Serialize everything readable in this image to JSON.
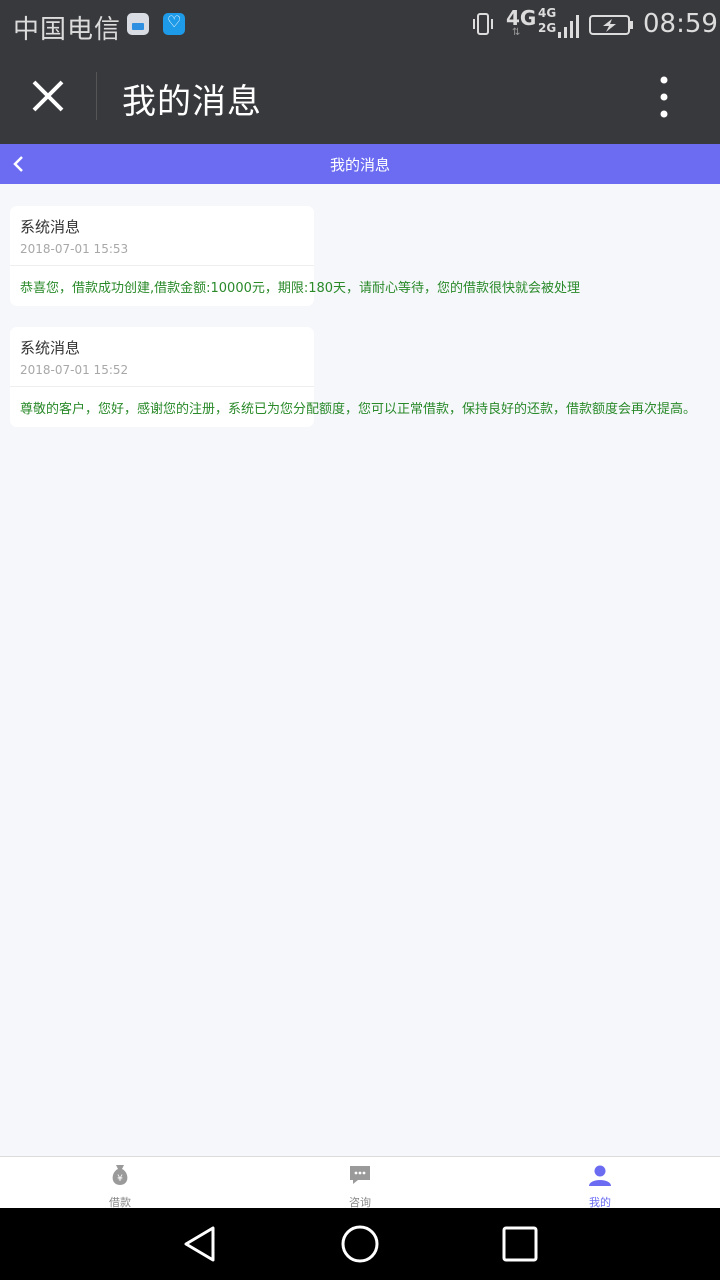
{
  "status_bar": {
    "carrier": "中国电信",
    "network_primary": "4G",
    "network_secondary": "4G\n2G",
    "time": "08:59"
  },
  "app_header": {
    "title": "我的消息"
  },
  "web_nav": {
    "title": "我的消息"
  },
  "messages": [
    {
      "title": "系统消息",
      "time": "2018-07-01 15:53",
      "body": "恭喜您，借款成功创建,借款金额:10000元，期限:180天，请耐心等待，您的借款很快就会被处理"
    },
    {
      "title": "系统消息",
      "time": "2018-07-01 15:52",
      "body": "尊敬的客户，您好，感谢您的注册，系统已为您分配额度，您可以正常借款，保持良好的还款，借款额度会再次提高。"
    }
  ],
  "tabs": [
    {
      "label": "借款",
      "icon": "money-bag-icon",
      "active": false
    },
    {
      "label": "咨询",
      "icon": "chat-bubble-icon",
      "active": false
    },
    {
      "label": "我的",
      "icon": "user-icon",
      "active": true
    }
  ],
  "colors": {
    "accent": "#6b6cf2",
    "message_text": "#2a8a2a",
    "header_bg": "#38393d"
  }
}
